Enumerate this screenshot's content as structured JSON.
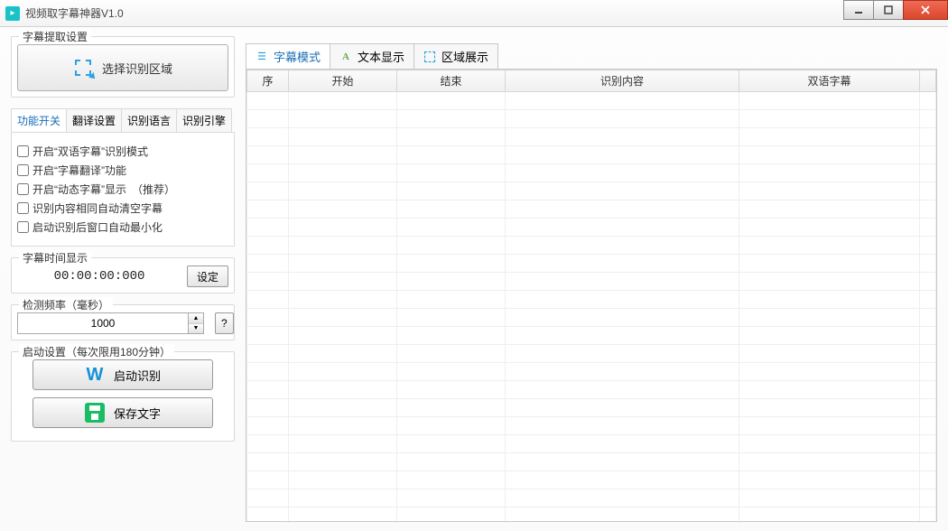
{
  "window": {
    "title": "视频取字幕神器V1.0"
  },
  "left": {
    "extract_group": "字幕提取设置",
    "select_region_btn": "选择识别区域",
    "sub_tabs": [
      "功能开关",
      "翻译设置",
      "识别语言",
      "识别引擎"
    ],
    "checks": [
      "开启“双语字幕”识别模式",
      "开启“字幕翻译”功能",
      "开启“动态字幕”显示　（推荐）",
      "识别内容相同自动清空字幕",
      "启动识别后窗口自动最小化"
    ],
    "time_group": "字幕时间显示",
    "timecode": "00:00:00:000",
    "set_btn": "设定",
    "freq_group": "检测频率（毫秒）",
    "freq_value": "1000",
    "help_btn": "?",
    "start_group": "启动设置（每次限用180分钟）",
    "start_btn": "启动识别",
    "save_btn": "保存文字"
  },
  "right": {
    "tabs": [
      "字幕模式",
      "文本显示",
      "区域展示"
    ],
    "columns": [
      "序",
      "开始",
      "结束",
      "识别内容",
      "双语字幕"
    ]
  }
}
